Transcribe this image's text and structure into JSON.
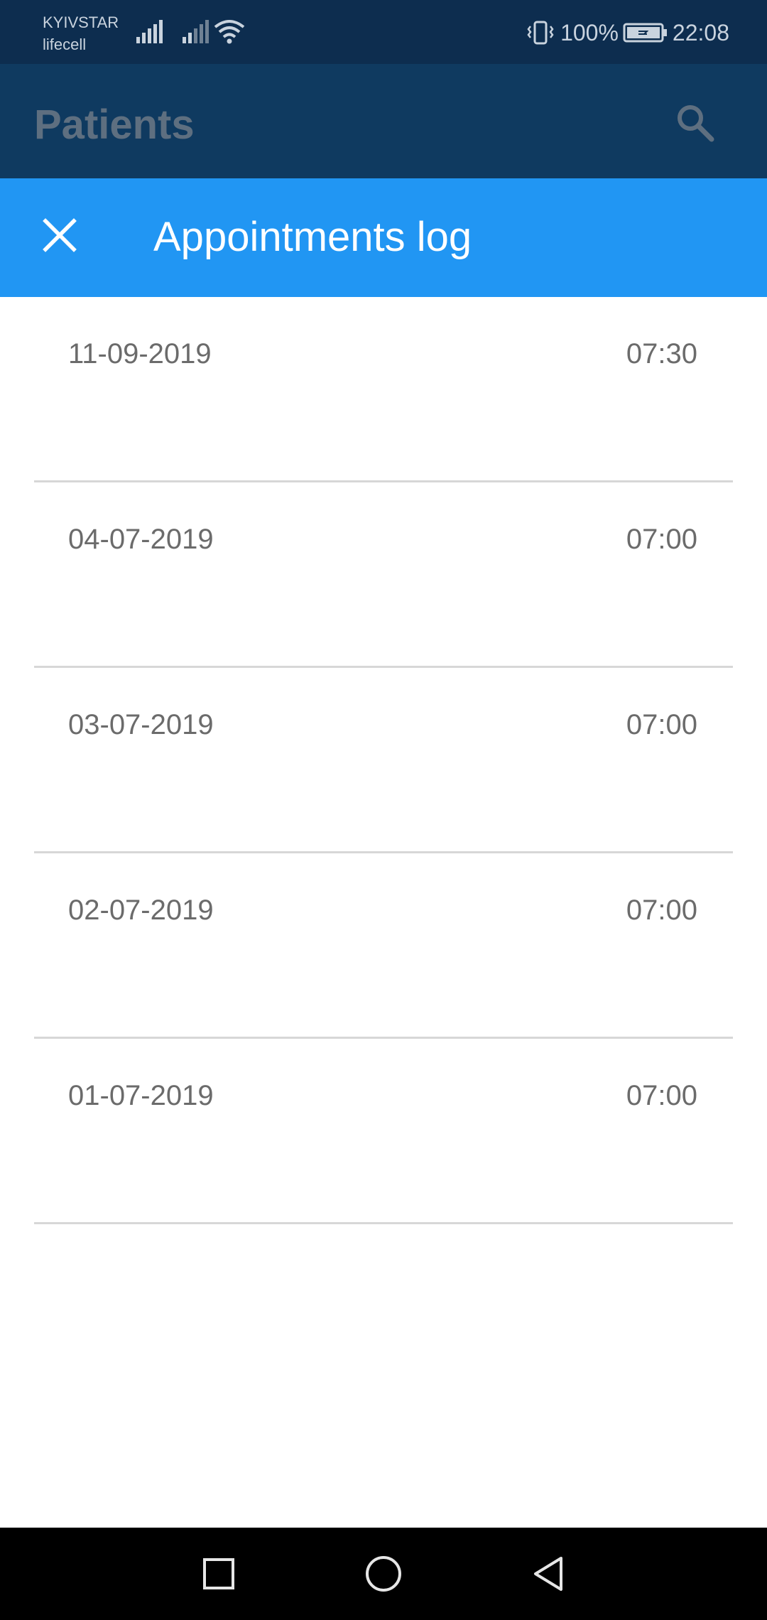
{
  "status_bar": {
    "carrier_1": "KYIVSTAR",
    "carrier_2": "lifecell",
    "battery_percent": "100%",
    "time": "22:08",
    "icons": [
      "vibrate-icon",
      "signal-icon",
      "wifi-icon",
      "battery-icon"
    ]
  },
  "app_bar": {
    "title": "Patients",
    "search_icon": "search-icon"
  },
  "dialog": {
    "title": "Appointments log",
    "close_icon": "close-icon",
    "header_color": "#2196f3",
    "appointments": [
      {
        "date": "11-09-2019",
        "time": "07:30"
      },
      {
        "date": "04-07-2019",
        "time": "07:00"
      },
      {
        "date": "03-07-2019",
        "time": "07:00"
      },
      {
        "date": "02-07-2019",
        "time": "07:00"
      },
      {
        "date": "01-07-2019",
        "time": "07:00"
      }
    ]
  },
  "nav_bar": {
    "buttons": [
      "recents-square-icon",
      "home-circle-icon",
      "back-triangle-icon"
    ]
  }
}
